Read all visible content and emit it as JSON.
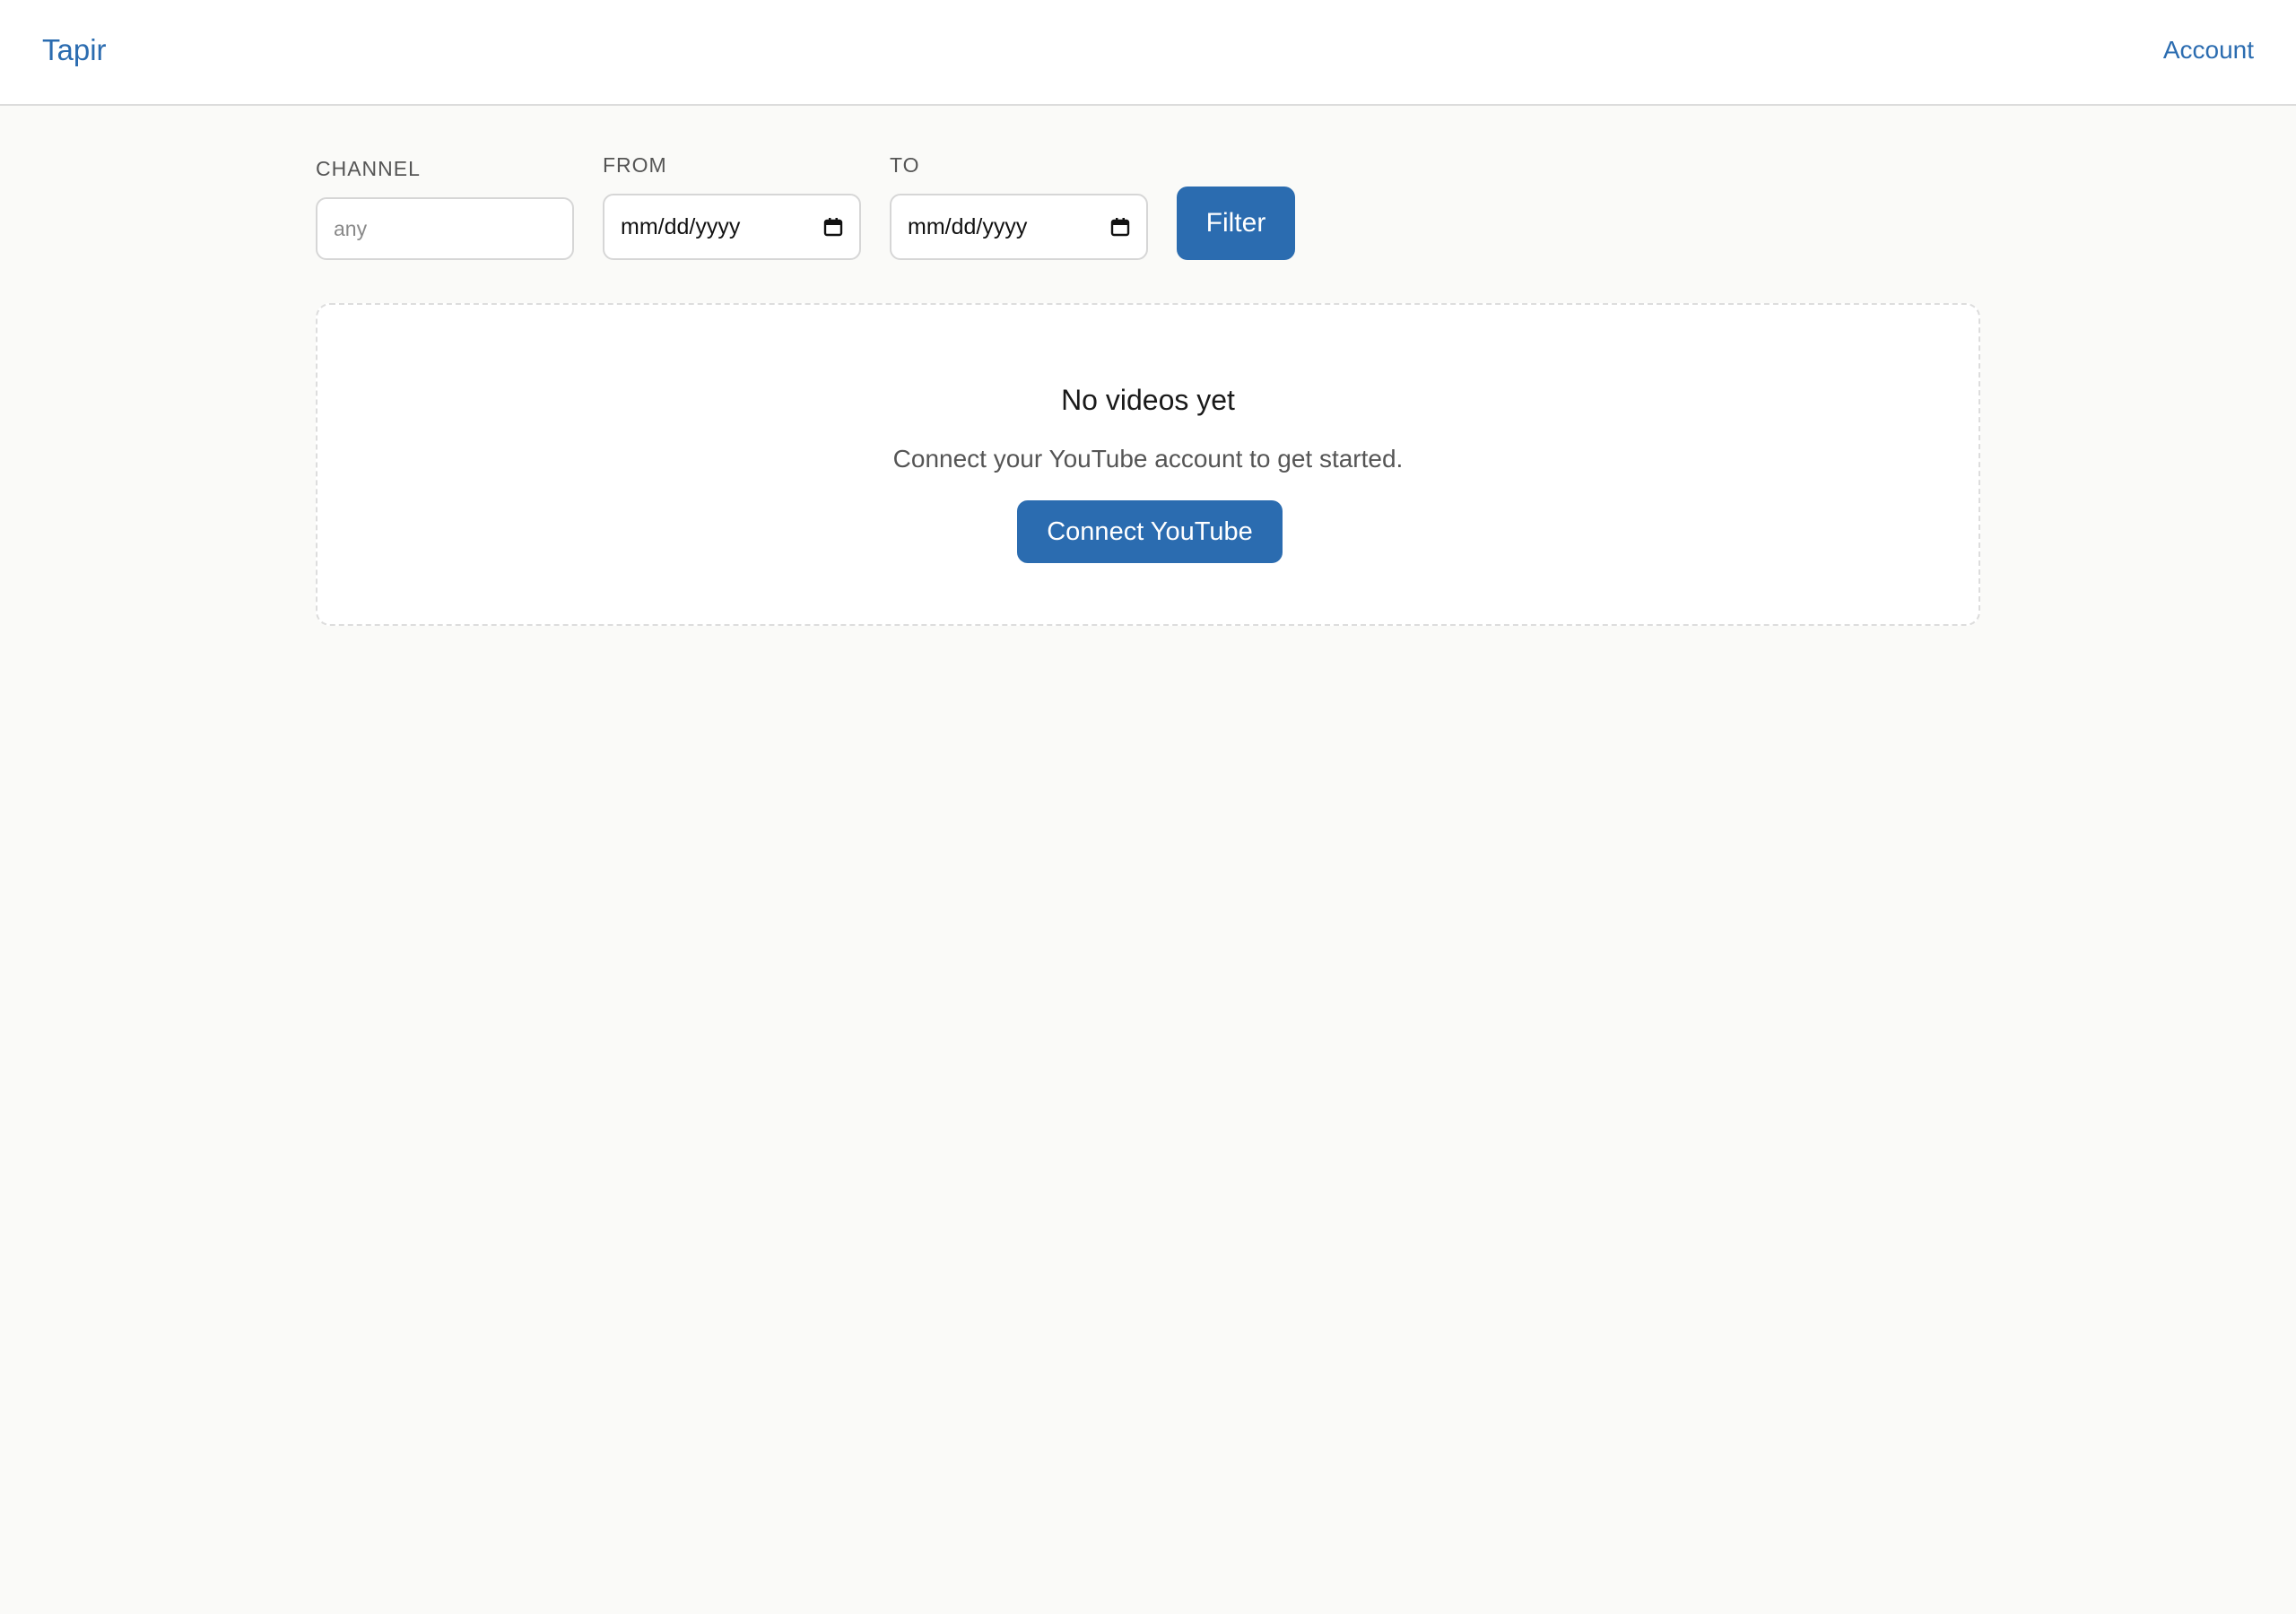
{
  "header": {
    "brand": "Tapir",
    "account_link": "Account"
  },
  "filters": {
    "channel": {
      "label": "CHANNEL",
      "placeholder": "any",
      "value": ""
    },
    "from": {
      "label": "FROM",
      "value": "mm/dd/yyyy"
    },
    "to": {
      "label": "TO",
      "value": "mm/dd/yyyy"
    },
    "filter_button": "Filter"
  },
  "empty_state": {
    "title": "No videos yet",
    "message": "Connect your YouTube account to get started.",
    "connect_button": "Connect YouTube"
  },
  "icons": {
    "date_picker": "calendar-icon"
  },
  "colors": {
    "accent": "#2b6cb0",
    "background": "#fafaf8",
    "surface": "#ffffff",
    "border": "#d6d6d6"
  }
}
